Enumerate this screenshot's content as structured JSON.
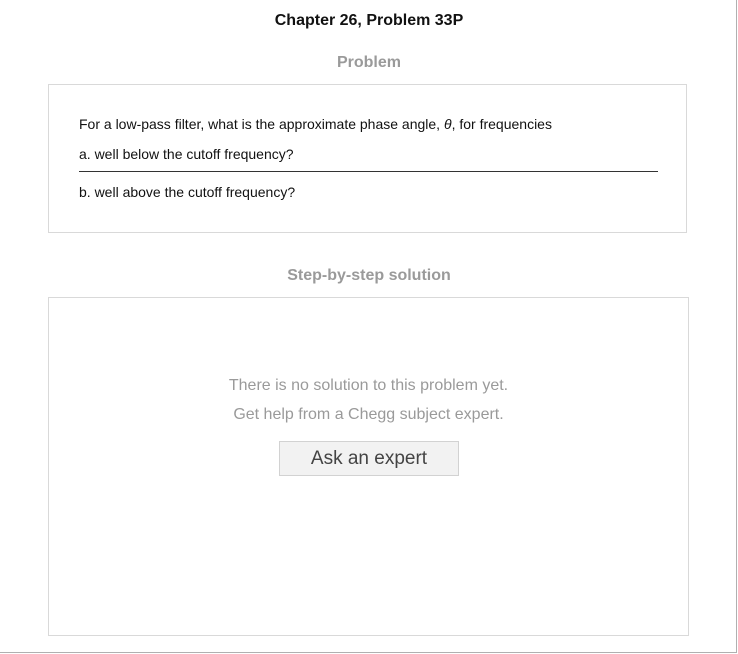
{
  "header": {
    "title": "Chapter 26, Problem 33P"
  },
  "problem": {
    "heading": "Problem",
    "intro_before": "For a low-pass filter, what is the approximate phase angle, ",
    "symbol": "θ",
    "intro_after": ", for frequencies",
    "part_a": "a. well below the cutoff frequency?",
    "part_b": "b. well above the cutoff frequency?"
  },
  "solution": {
    "heading": "Step-by-step solution",
    "message_line1": "There is no solution to this problem yet.",
    "message_line2": "Get help from a Chegg subject expert.",
    "ask_button_label": "Ask an expert"
  }
}
